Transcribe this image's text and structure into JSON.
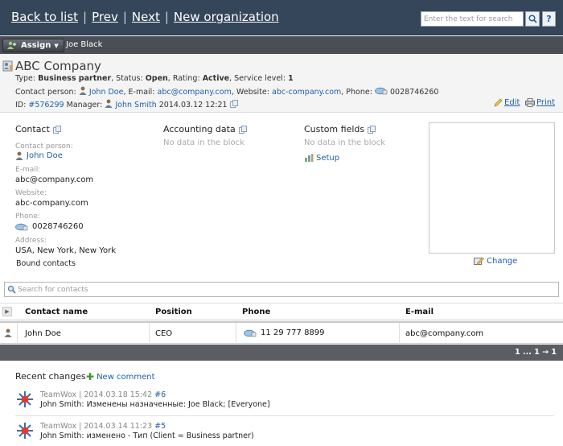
{
  "nav": {
    "back": "Back to list",
    "prev": "Prev",
    "next": "Next",
    "new_org": "New organization",
    "search_placeholder": "Enter the text for search",
    "help": "?"
  },
  "assign": {
    "button": "Assign",
    "assignee": "Joe Black"
  },
  "header": {
    "company": "ABC Company",
    "type_label": "Type:",
    "type": "Business partner",
    "status_label": ", Status:",
    "status": "Open",
    "rating_label": ", Rating:",
    "rating": "Active",
    "service_label": ", Service level:",
    "service": "1",
    "contact_label": "Contact person:",
    "contact": "John Doe",
    "email_label": ", E-mail:",
    "email": "abc@company.com",
    "website_label": ", Website:",
    "website": "abc-company.com",
    "phone_label": ", Phone:",
    "phone": "0028746260",
    "id_label": "ID:",
    "id": "#576299",
    "manager_label": "Manager:",
    "manager": "John Smith",
    "date": "2014.03.12 12:21",
    "edit": "Edit",
    "print": "Print"
  },
  "contact_block": {
    "title": "Contact",
    "person_label": "Contact person:",
    "person": "John Doe",
    "email_label": "E-mail:",
    "email": "abc@company.com",
    "website_label": "Website:",
    "website": "abc-company.com",
    "phone_label": "Phone:",
    "phone": "0028746260",
    "address_label": "Address:",
    "address": "USA, New York, New York",
    "bound": "Bound contacts"
  },
  "accounting_block": {
    "title": "Accounting data",
    "nodata": "No data in the block"
  },
  "custom_block": {
    "title": "Custom fields",
    "nodata": "No data in the block",
    "setup": "Setup"
  },
  "photo": {
    "change": "Change"
  },
  "contacts_search": {
    "placeholder": "Search for contacts"
  },
  "table": {
    "headers": [
      "Contact name",
      "Position",
      "Phone",
      "E-mail"
    ],
    "rows": [
      {
        "name": "John Doe",
        "position": "CEO",
        "phone": "11 29 777 8899",
        "email": "abc@company.com"
      }
    ],
    "pager": "1 ... 1 → 1"
  },
  "recent": {
    "title": "Recent changes",
    "new_comment": "New comment",
    "items": [
      {
        "source": "TeamWox",
        "date": "2014.03.18 15:42",
        "num": "#6",
        "text": "John Smith: Изменены назначенные: Joe Black; [Everyone]"
      },
      {
        "source": "TeamWox",
        "date": "2014.03.14 11:23",
        "num": "#5",
        "text": "John Smith: изменено - Тип (Client = Business partner)"
      }
    ]
  },
  "colors": {
    "topbar": "#35455a",
    "assignbar": "#4a4f55",
    "link": "#1f5fa8",
    "pagerbar": "#5a5e63"
  }
}
